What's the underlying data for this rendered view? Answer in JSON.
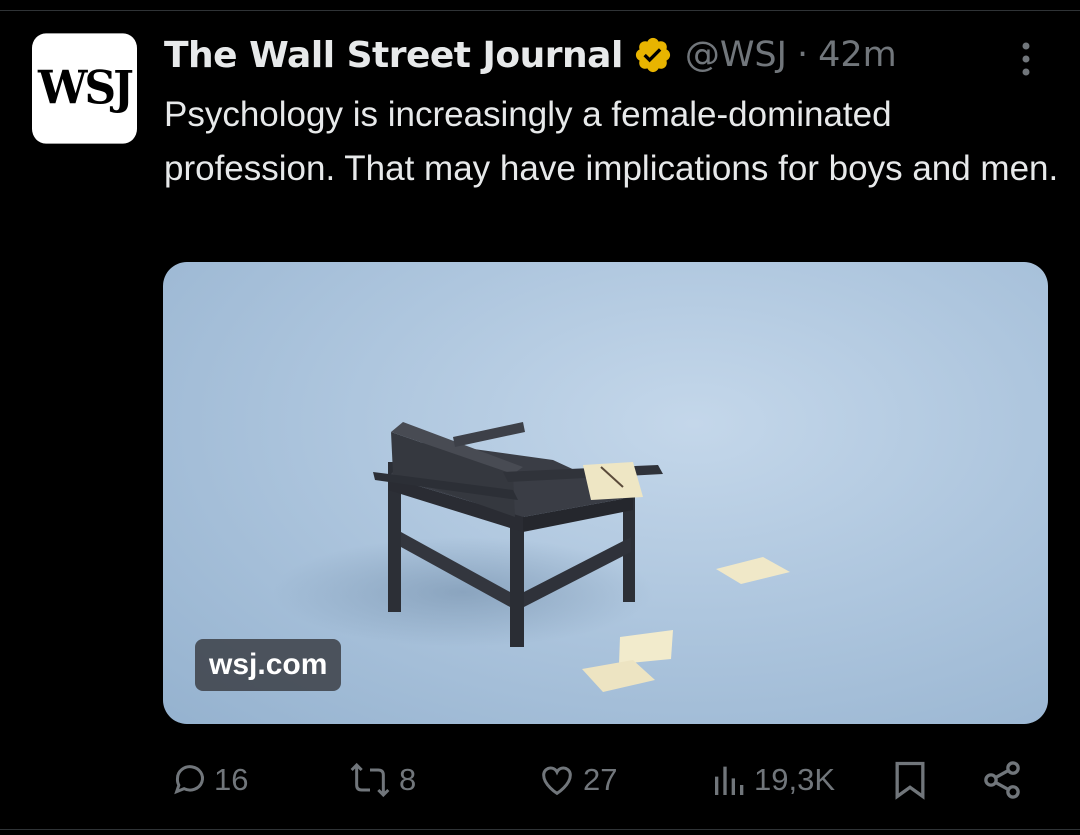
{
  "tweet": {
    "avatar_text": "WSJ",
    "name": "The Wall Street Journal",
    "handle": "@WSJ",
    "separator": "·",
    "time": "42m",
    "text": "Psychology is increasingly a female-dominated profession. That may have implications for boys and men.",
    "media_site": "wsj.com"
  },
  "actions": {
    "replies": "16",
    "reposts": "8",
    "likes": "27",
    "views": "19,3K"
  },
  "colors": {
    "background": "#000000",
    "text": "#e7e9ea",
    "muted": "#71767b",
    "verified_badge": "#e8b400"
  },
  "icons": [
    "verified-badge-icon",
    "more-options-icon",
    "reply-icon",
    "repost-icon",
    "like-icon",
    "views-icon",
    "bookmark-icon",
    "share-icon"
  ]
}
